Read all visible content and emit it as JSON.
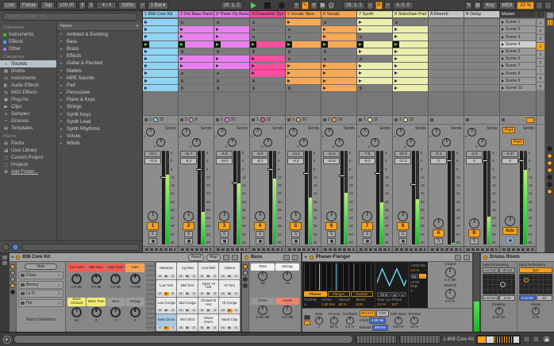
{
  "colors": {
    "accent": "#f7a021",
    "play": "#4be04b"
  },
  "labels": {
    "sends": "Sends",
    "solo": "S"
  },
  "toolbar": {
    "link": "Link",
    "follow": "Follow",
    "tap": "Tap",
    "tempo": "100.00",
    "sig": "4 / 4",
    "groove": "100%",
    "quant": "1 Bar",
    "pos": "29. 1. 2",
    "loop_start": "29. 1. 1",
    "loop_len": "4. 0. 0",
    "key": "Key",
    "midi": "MIDI",
    "cpu": "22 %"
  },
  "browser": {
    "search_placeholder": "Search (Cmd + F)",
    "collections_label": "Collections",
    "collections": [
      {
        "label": "Instruments",
        "color": "#3dc300"
      },
      {
        "label": "Effects",
        "color": "#4ba3f5"
      },
      {
        "label": "Other",
        "color": "#b06af5"
      }
    ],
    "categories_label": "Categories",
    "categories": [
      {
        "label": "Sounds",
        "icon": "♪",
        "sel": "sel"
      },
      {
        "label": "Drums",
        "icon": "▦",
        "sel": ""
      },
      {
        "label": "Instruments",
        "icon": "◷",
        "sel": ""
      },
      {
        "label": "Audio Effects",
        "icon": "◧",
        "sel": ""
      },
      {
        "label": "MIDI Effects",
        "icon": "⇆",
        "sel": ""
      },
      {
        "label": "Plug-Ins",
        "icon": "▣",
        "sel": ""
      },
      {
        "label": "Clips",
        "icon": "▶",
        "sel": ""
      },
      {
        "label": "Samples",
        "icon": "≡",
        "sel": ""
      },
      {
        "label": "Grooves",
        "icon": "≈",
        "sel": ""
      },
      {
        "label": "Templates",
        "icon": "▤",
        "sel": ""
      }
    ],
    "places_label": "Places",
    "places": [
      {
        "label": "Packs",
        "icon": "▤",
        "u": ""
      },
      {
        "label": "User Library",
        "icon": "◪",
        "u": ""
      },
      {
        "label": "Current Project",
        "icon": "▢",
        "u": ""
      },
      {
        "label": "Projects",
        "icon": "▢",
        "u": ""
      },
      {
        "label": "Add Folder...",
        "icon": "⊞",
        "u": "underline"
      }
    ],
    "name_header": "Name",
    "items": [
      "Ambient & Evolving",
      "Bass",
      "Brass",
      "Effects",
      "Guitar & Plucked",
      "Mallets",
      "MPE Sounds",
      "Pad",
      "Percussive",
      "Piano & Keys",
      "Strings",
      "Synth Keys",
      "Synth Lead",
      "Synth Rhythmic",
      "Voices",
      "Winds"
    ]
  },
  "mixer_scale": [
    "6",
    "0",
    "6",
    "12",
    "18",
    "24",
    "30",
    "36",
    "42",
    "48",
    "54",
    "60"
  ],
  "session": {
    "tracks": [
      {
        "name": "1 808 Core Kit",
        "css": "--clip:#8fd3f5;--hdr:#8cc7e8",
        "slots": [
          "clip",
          "clip",
          "clip",
          "play",
          "clip",
          "clip",
          "clip",
          "clip",
          "clip",
          "clip"
        ],
        "st0": "1",
        "st1": "32",
        "box1": "-19.1",
        "box2": "-11.5",
        "num": "1",
        "meter": "height:75%",
        "fader": "top:27%"
      },
      {
        "name": "2 Oxi Bass Rack",
        "css": "--clip:#ea80f0;--hdr:#e17fe3",
        "slots": [
          "stop",
          "clip",
          "clip",
          "play",
          "stop",
          "clip",
          "clip",
          "stop",
          "stop",
          "stop"
        ],
        "st0": "3",
        "st1": "8",
        "box1": "-11.7",
        "box2": "-6.2",
        "num": "2",
        "meter": "height:35%",
        "fader": "top:19%"
      },
      {
        "name": "3 Three Op Bass",
        "css": "--clip:#ea80f0;--hdr:#e17fe3",
        "slots": [
          "stop",
          "clip",
          "clip",
          "play",
          "stop",
          "clip",
          "clip",
          "stop",
          "stop",
          "stop"
        ],
        "st0": "1",
        "st1": "32",
        "box1": "-6.5",
        "box2": "-16.0",
        "num": "3",
        "meter": "height:65%",
        "fader": "top:33%"
      },
      {
        "name": "4 Crossover Syn",
        "css": "--clip:#f7509e;--hdr:#f0509a",
        "slots": [
          "stop",
          "stop",
          "stop",
          "play",
          "stop",
          "clip",
          "clip",
          "clip",
          "stop",
          "stop"
        ],
        "st0": "1",
        "st1": "32",
        "box1": "-8.0",
        "box2": "-6.3",
        "num": "4",
        "meter": "height:70%",
        "fader": "top:19%"
      },
      {
        "name": "5 Vocals Slice",
        "css": "--clip:#f9a853;--hdr:#f5a44f",
        "slots": [
          "clip",
          "stop",
          "stop",
          "play",
          "stop",
          "stop",
          "clip",
          "clip",
          "clip",
          "stop"
        ],
        "st0": "1",
        "st1": "32",
        "box1": "-13.4",
        "box2": "-9.3",
        "num": "5",
        "meter": "height:50%",
        "fader": "top:23%"
      },
      {
        "name": "6 Vocals",
        "css": "--clip:#f9a853;--hdr:#f5a44f",
        "slots": [
          "stop",
          "clip",
          "clip",
          "play",
          "stop",
          "stop",
          "clip",
          "clip",
          "clip",
          "clip"
        ],
        "st0": "2",
        "st1": "16",
        "box1": "-11.9",
        "box2": "-10.6",
        "num": "6",
        "meter": "height:55%",
        "fader": "top:25%"
      },
      {
        "name": "7 Synth",
        "css": "--clip:#ebeeae;--hdr:#e4e8a2",
        "slots": [
          "clip",
          "clip",
          "stop",
          "play",
          "clip",
          "stop",
          "clip",
          "clip",
          "clip",
          "stop"
        ],
        "st0": "1",
        "st1": "32",
        "box1": "-7.5",
        "box2": "-9.3",
        "num": "7",
        "meter": "height:45%",
        "fader": "top:23%"
      },
      {
        "name": "8 Sidechain Pad",
        "css": "--clip:#ebeeae;--hdr:#e4e8a2",
        "slots": [
          "stop",
          "clip",
          "clip",
          "play",
          "clip",
          "clip",
          "clip",
          "clip",
          "clip",
          "clip"
        ],
        "st0": "1",
        "st1": "32",
        "box1": "-20.3",
        "box2": "-17.3",
        "num": "8",
        "meter": "height:48%",
        "fader": "top:35%"
      }
    ],
    "returns": [
      {
        "name": "A Reverb",
        "css": "--clip:#9a9a9a;--hdr:#c6c6c6",
        "slots": [
          "none",
          "none",
          "none",
          "none",
          "none",
          "none",
          "none",
          "none",
          "none",
          "none"
        ],
        "box1": "-6.4",
        "box2": "0",
        "num": "A",
        "meter": "height:2%",
        "fader": "top:9%"
      },
      {
        "name": "B Delay",
        "css": "--clip:#9a9a9a;--hdr:#c6c6c6",
        "slots": [
          "none",
          "none",
          "none",
          "none",
          "none",
          "none",
          "none",
          "none",
          "none",
          "none"
        ],
        "box1": "-2.3",
        "box2": "0",
        "num": "B",
        "meter": "height:30%",
        "fader": "top:9%"
      }
    ],
    "master": {
      "name": "Master",
      "post_a": "Post",
      "post_b": "Post",
      "box1": "-0.47",
      "box2": "0",
      "solo": "Solo",
      "meter": "height:80%",
      "fader": "top:9%"
    },
    "scenes": [
      {
        "label": "Scene 1",
        "num": "1",
        "sel": ""
      },
      {
        "label": "Scene 2",
        "num": "2",
        "sel": ""
      },
      {
        "label": "Scene 3",
        "num": "3",
        "sel": ""
      },
      {
        "label": "Scene 4",
        "num": "4",
        "sel": "sel"
      },
      {
        "label": "Scene 5",
        "num": "5",
        "sel": ""
      },
      {
        "label": "Scene 6",
        "num": "6",
        "sel": ""
      },
      {
        "label": "Scene 7",
        "num": "7",
        "sel": ""
      },
      {
        "label": "Scene 8",
        "num": "8",
        "sel": ""
      },
      {
        "label": "Scene 9",
        "num": "9",
        "sel": ""
      },
      {
        "label": "Scene 10",
        "num": "10",
        "sel": ""
      }
    ],
    "mixer_toggles": [
      {
        "css": "background:#1f1f1f"
      },
      {
        "css": "background:#f7a021"
      },
      {
        "css": "background:#f7a021"
      },
      {
        "css": "background:#f7a021"
      },
      {
        "css": "background:#1f1f1f"
      },
      {
        "css": "background:#1f1f1f"
      },
      {
        "css": "background:#f7a021"
      }
    ]
  },
  "devices": {
    "drum": {
      "title": "808 Core Kit",
      "rand": "Rand",
      "map": "Map",
      "new_btn": "New",
      "variations": [
        {
          "label": "Clean"
        },
        {
          "label": "Boomy"
        },
        {
          "label": "Lo Fi"
        },
        {
          "label": "Hot"
        }
      ],
      "variations_label": "Macro Variations",
      "macros": [
        {
          "label": "Low Gain",
          "value": "0.0 dB",
          "hdr": "background:#f25d52"
        },
        {
          "label": "Mid Gain",
          "value": "0.0 dB",
          "hdr": "background:#f25d52"
        },
        {
          "label": "High Gain",
          "value": "0.0 dB",
          "hdr": "background:#f25d52"
        },
        {
          "label": "Gain",
          "value": "-7.0 dB",
          "hdr": "background:#f7a351"
        },
        {
          "label": "Drive Amount",
          "value": "62",
          "hdr": "background:#f3ec73"
        },
        {
          "label": "Drive Tone",
          "value": "0",
          "hdr": "background:#f3ec73"
        },
        {
          "label": "Glue",
          "value": "0",
          "hdr": ""
        },
        {
          "label": "Vintage",
          "value": "0",
          "hdr": ""
        }
      ],
      "pad_m": "M",
      "pad_p": "▶",
      "pad_s": "S",
      "pads": [
        {
          "name": "Maracas",
          "sel": "",
          "play": ""
        },
        {
          "name": "Cymbal",
          "sel": "",
          "play": ""
        },
        {
          "name": "Cow Bell",
          "sel": "",
          "play": ""
        },
        {
          "name": "Claves",
          "sel": "",
          "play": ""
        },
        {
          "name": "Low Tom",
          "sel": "",
          "play": "background:#f7a021"
        },
        {
          "name": "Mid Tom",
          "sel": "",
          "play": ""
        },
        {
          "name": "Open Hi Hat",
          "sel": "",
          "play": ""
        },
        {
          "name": "Hi Tom",
          "sel": "",
          "play": ""
        },
        {
          "name": "Low Conga",
          "sel": "",
          "play": ""
        },
        {
          "name": "Mid Conga",
          "sel": "",
          "play": ""
        },
        {
          "name": "Closed Hi Hat",
          "sel": "",
          "play": ""
        },
        {
          "name": "Hi-Conga",
          "sel": "",
          "play": "background:#f7a021"
        },
        {
          "name": "Bass Drum",
          "sel": "background:#a9c9e4",
          "play": "background:#f7a021"
        },
        {
          "name": "Rim Shot",
          "sel": "",
          "play": ""
        },
        {
          "name": "Snare Drum",
          "sel": "",
          "play": ""
        },
        {
          "name": "Hand Clap",
          "sel": "",
          "play": ""
        }
      ]
    },
    "bass": {
      "title": "Bass",
      "params": [
        {
          "label": "Tone",
          "value": "36",
          "hdr": "background:#f2f2f2"
        },
        {
          "label": "Decay",
          "value": "75",
          "hdr": "background:#f2f2f2"
        },
        {
          "label": "Drive",
          "value": "0.00 dB",
          "hdr": ""
        },
        {
          "label": "Level",
          "value": "0.0 dB",
          "hdr": "background:#f0836e"
        }
      ]
    },
    "phaser": {
      "title": "Phaser-Flanger",
      "modes": [
        {
          "label": "Phaser",
          "on": "on"
        },
        {
          "label": "Flanger",
          "on": ""
        },
        {
          "label": "Doubler",
          "on": ""
        }
      ],
      "params": [
        {
          "label": "Notches",
          "value": "4"
        },
        {
          "label": "Center",
          "value": "1.00 kHz"
        },
        {
          "label": "Spread",
          "value": "50 %"
        },
        {
          "label": "Blend",
          "value": "0.00"
        }
      ],
      "lfo": {
        "wave": "Tri ▾",
        "phase_btn": "φ",
        "stereo_btn": "◐",
        "duty_label": "Duty Cyc",
        "duty": "0.0 %",
        "phase_label": "Phase",
        "phase": "0.0°"
      },
      "lfo2": {
        "mix_label": "LFO2 Mix",
        "mix": "0.0 %",
        "hz_btn": "Hz",
        "note_btn": "♪",
        "rate_label": "LFO2 Rate",
        "rate": "2"
      },
      "output_label": "Output",
      "output": "0.0 dB",
      "warmth_label": "Warmth",
      "warmth": "0.0 %",
      "sync_hz": "~",
      "sync_note": "♪",
      "rate_label": "Rate",
      "rate": "2",
      "amount_label": "Amount",
      "amount": "65 %",
      "feedback_label": "Feedback",
      "feedback": "0.0 %",
      "env_btn": "Env Fol",
      "env_amount": "0.00",
      "attack_label": "Attack",
      "attack": "1.00 ms",
      "release_label": "Release",
      "release": "200 ms",
      "safebass_label": "Safe Bass",
      "safebass": "100 Hz",
      "drywet_label": "Dry/Wet",
      "drywet": "34 %"
    },
    "reverb": {
      "title": "Drums Room",
      "input_label": "Input Processing",
      "lo_cut": "Lo Cut",
      "hi_cut": "Hi Cut",
      "freq": "4.33 kHz",
      "q": "4.04",
      "early_label": "Early Reflections",
      "spin": "Spin",
      "spin_hz": "3.11 Hz",
      "spin_amt": "22",
      "predelay_label": "Predelay",
      "predelay": "8.00 ms",
      "shape_label": "Shape",
      "shape": "0.26"
    }
  },
  "status_bar": {
    "selection": "1-808 Core Kit"
  }
}
